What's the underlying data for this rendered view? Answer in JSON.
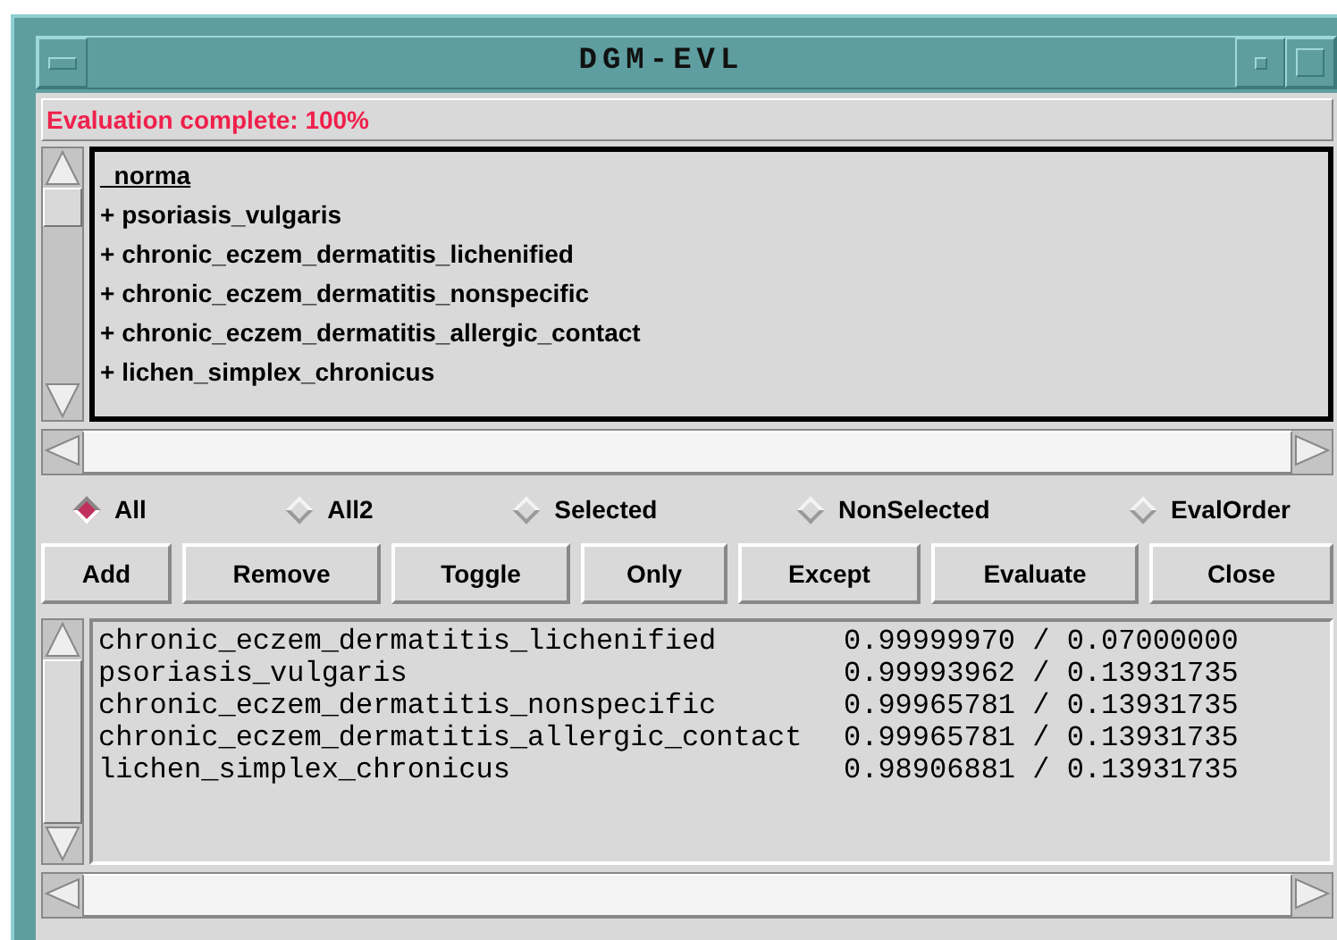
{
  "window": {
    "title": "DGM-EVL"
  },
  "status": {
    "text": "Evaluation complete: 100%"
  },
  "class_list": [
    {
      "text": "_norma",
      "selected": true
    },
    {
      "text": "+ psoriasis_vulgaris",
      "selected": false
    },
    {
      "text": "+ chronic_eczem_dermatitis_lichenified",
      "selected": false
    },
    {
      "text": "+ chronic_eczem_dermatitis_nonspecific",
      "selected": false
    },
    {
      "text": "+ chronic_eczem_dermatitis_allergic_contact",
      "selected": false
    },
    {
      "text": "+ lichen_simplex_chronicus",
      "selected": false
    }
  ],
  "filter_options": [
    {
      "label": "All",
      "selected": true
    },
    {
      "label": "All2",
      "selected": false
    },
    {
      "label": "Selected",
      "selected": false
    },
    {
      "label": "NonSelected",
      "selected": false
    },
    {
      "label": "EvalOrder",
      "selected": false
    }
  ],
  "buttons": [
    "Add",
    "Remove",
    "Toggle",
    "Only",
    "Except",
    "Evaluate",
    "Close"
  ],
  "results": [
    {
      "name": "chronic_eczem_dermatitis_lichenified",
      "score": "0.99999970 / 0.07000000"
    },
    {
      "name": "psoriasis_vulgaris",
      "score": "0.99993962 / 0.13931735"
    },
    {
      "name": "chronic_eczem_dermatitis_nonspecific",
      "score": "0.99965781 / 0.13931735"
    },
    {
      "name": "chronic_eczem_dermatitis_allergic_contact",
      "score": "0.99965781 / 0.13931735"
    },
    {
      "name": "lichen_simplex_chronicus",
      "score": "0.98906881 / 0.13931735"
    }
  ]
}
